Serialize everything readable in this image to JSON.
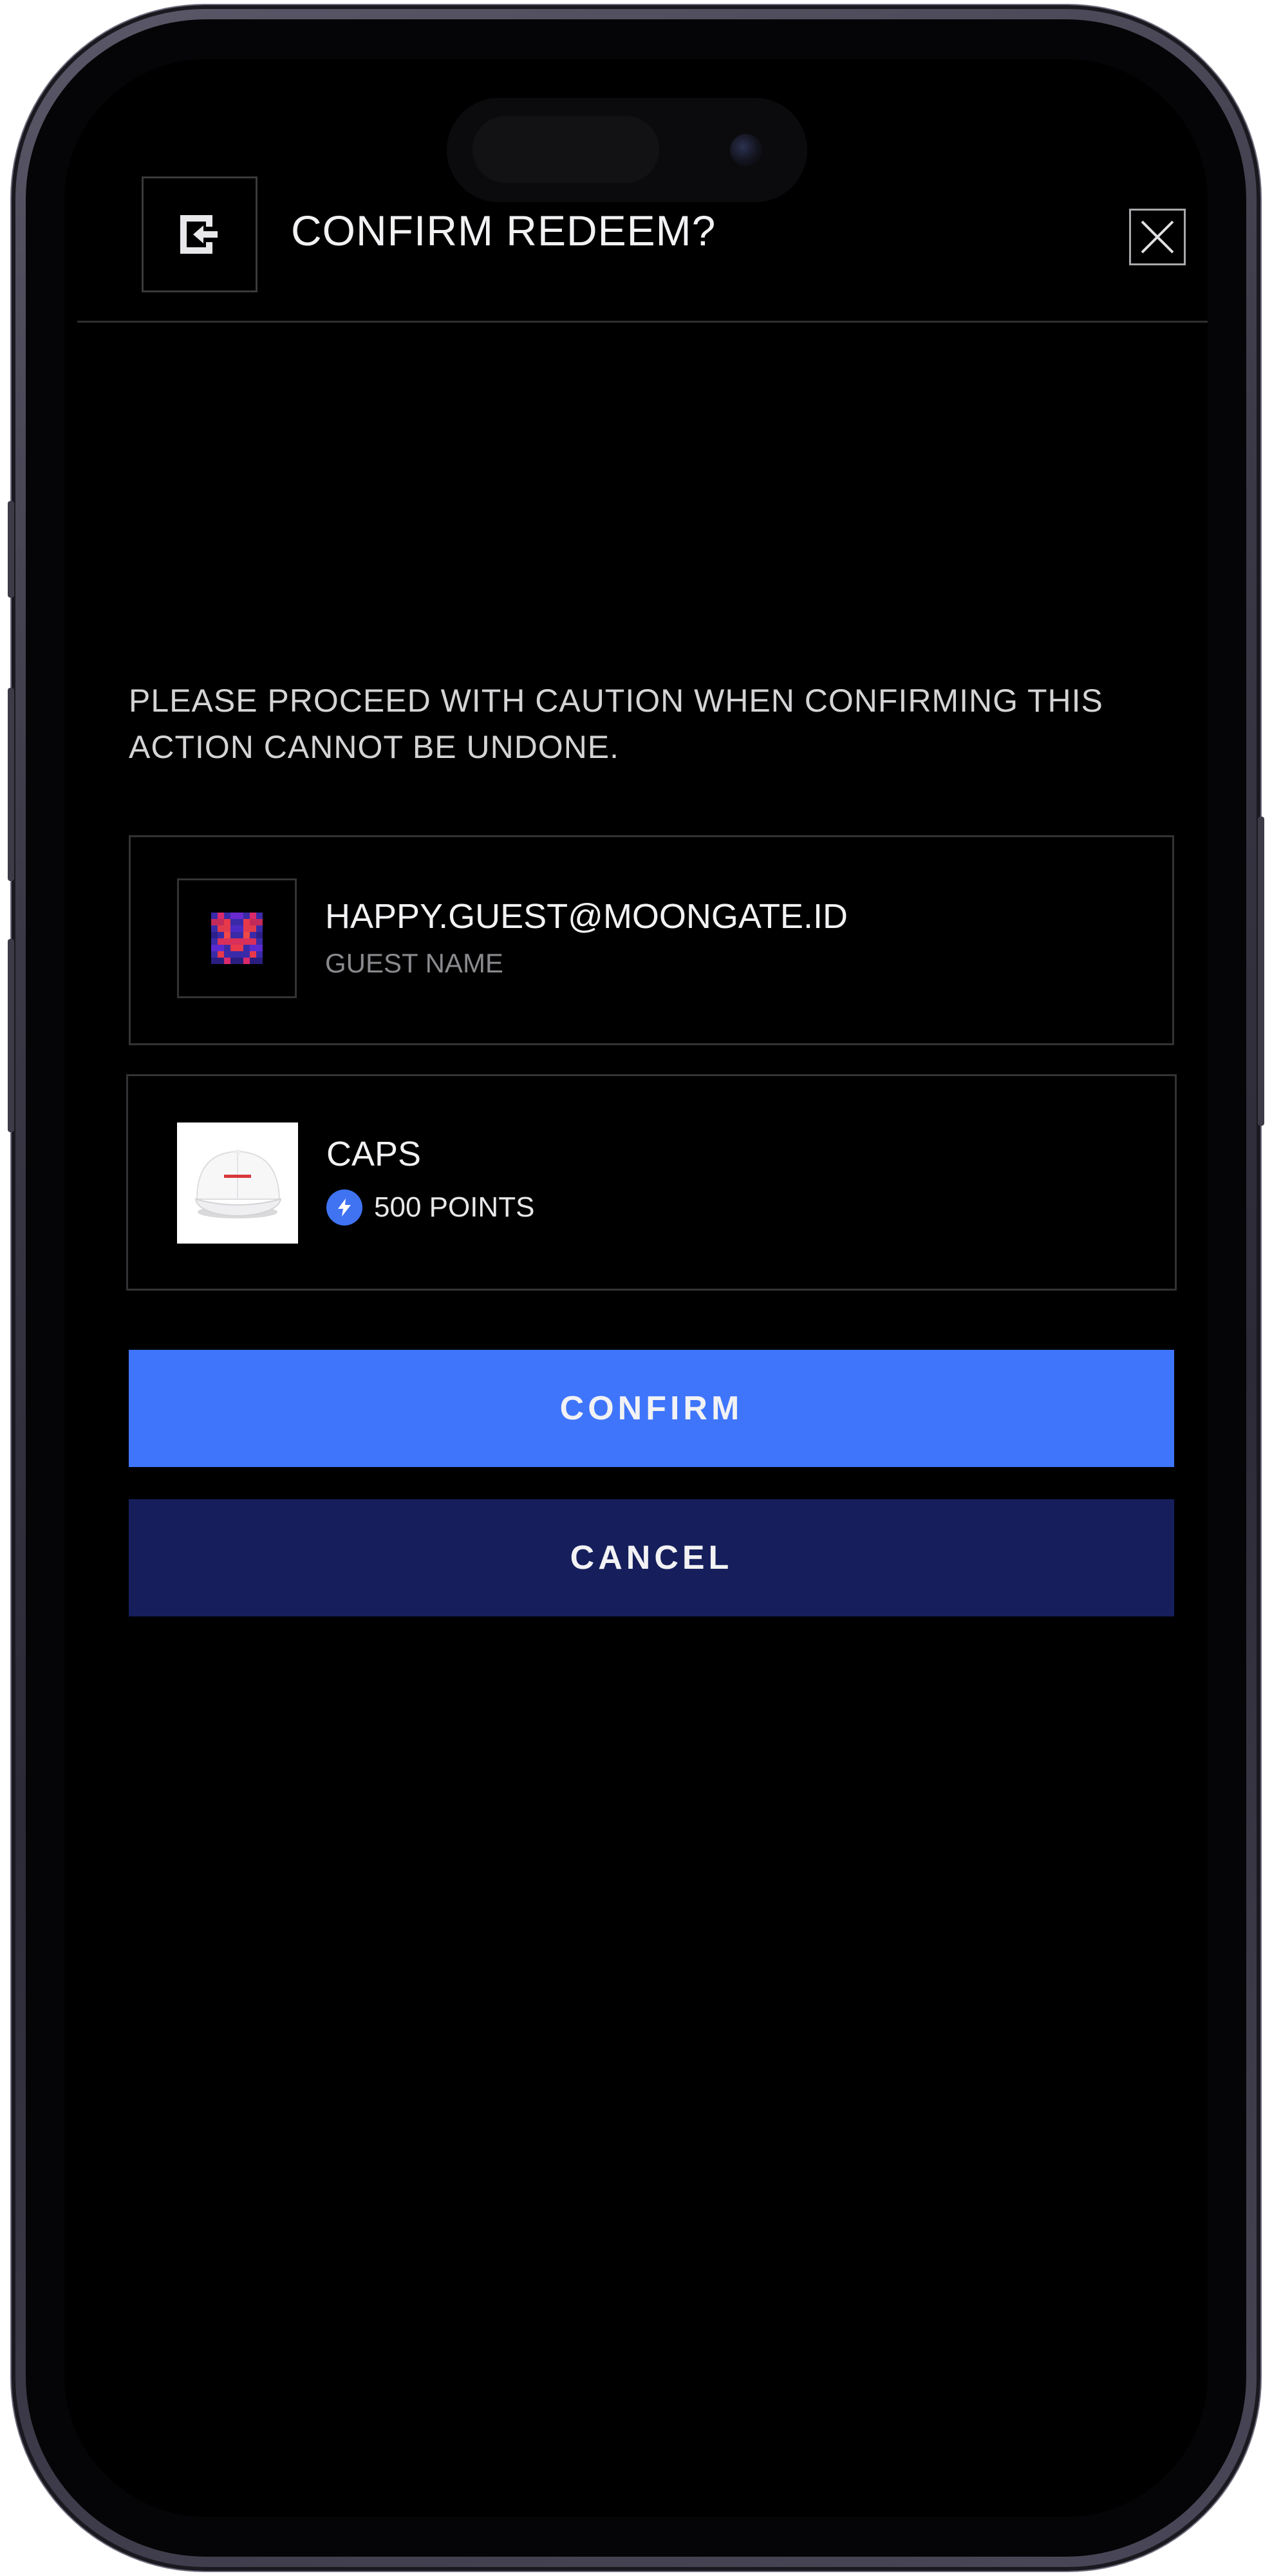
{
  "header": {
    "title": "CONFIRM REDEEM?",
    "exit_icon": "exit-icon",
    "close_icon": "close-icon"
  },
  "caution_text": "PLEASE PROCEED WITH CAUTION WHEN CONFIRMING THIS ACTION CANNOT BE UNDONE.",
  "guest": {
    "email": "HAPPY.GUEST@MOONGATE.ID",
    "label": "GUEST NAME",
    "avatar_icon": "pixel-avatar-icon"
  },
  "item": {
    "name": "CAPS",
    "points": "500 POINTS",
    "points_icon": "bolt-icon",
    "image_icon": "cap-icon"
  },
  "actions": {
    "confirm_label": "CONFIRM",
    "cancel_label": "CANCEL"
  },
  "colors": {
    "background": "#000000",
    "confirm": "#3f75fb",
    "cancel": "#161f5c",
    "points_badge": "#3f73f2",
    "text_primary": "#f2f2f4",
    "text_secondary": "#8a8a8e",
    "border": "#333336"
  }
}
